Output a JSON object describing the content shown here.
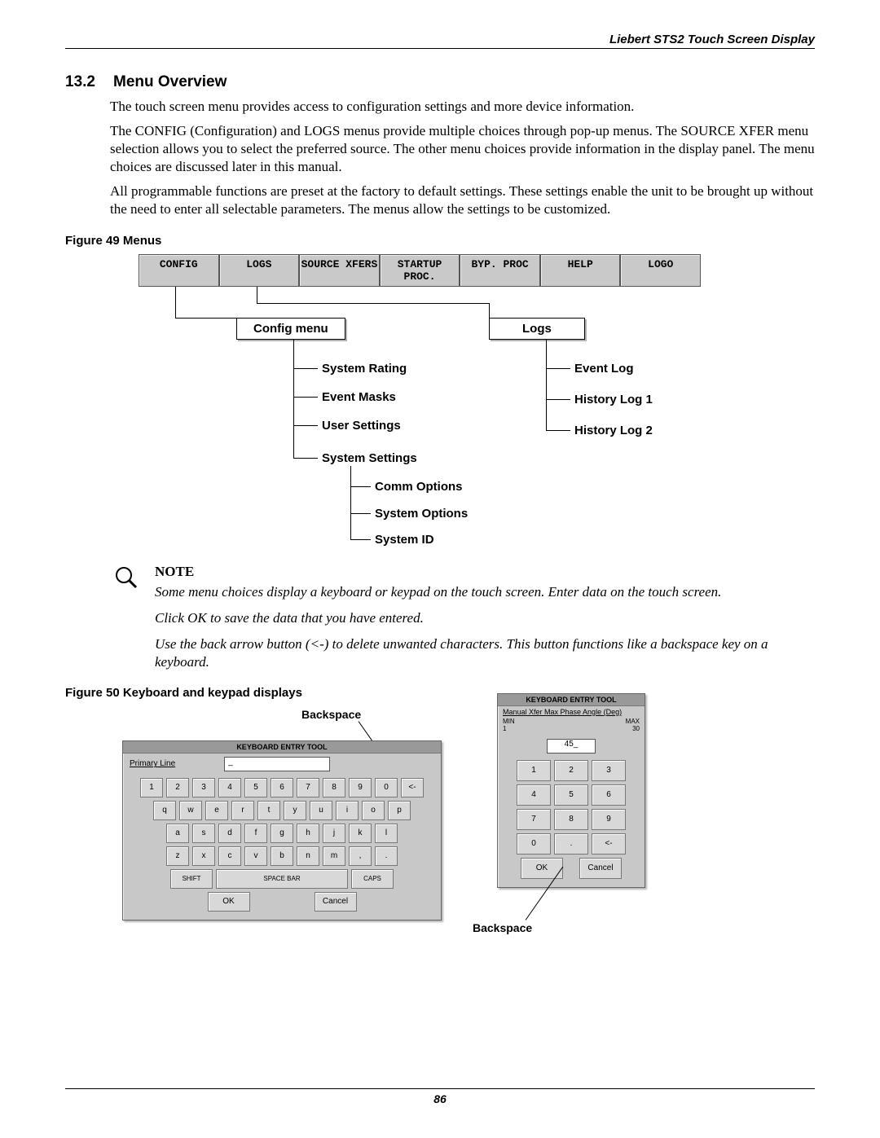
{
  "header": {
    "title": "Liebert STS2 Touch Screen Display"
  },
  "section": {
    "num": "13.2",
    "title": "Menu Overview"
  },
  "paragraphs": {
    "p1": "The touch screen menu provides access to configuration settings and more device information.",
    "p2": "The CONFIG (Configuration) and LOGS menus provide multiple choices through pop-up menus. The SOURCE XFER menu selection allows you to select the preferred source. The other menu choices provide information in the display panel. The menu choices are discussed later in this manual.",
    "p3": "All programmable functions are preset at the factory to default settings. These settings enable the unit to be brought up without the need to enter all selectable parameters. The menus allow the settings to be customized."
  },
  "fig49": {
    "caption": "Figure 49  Menus",
    "menubar": [
      "CONFIG",
      "LOGS",
      "SOURCE XFERS",
      "STARTUP PROC.",
      "BYP. PROC",
      "HELP",
      "LOGO"
    ],
    "box_config": "Config menu",
    "box_logs": "Logs",
    "config_items": [
      "System Rating",
      "Event Masks",
      "User Settings",
      "System Settings"
    ],
    "sys_sub": [
      "Comm Options",
      "System Options",
      "System ID"
    ],
    "logs_items": [
      "Event Log",
      "History Log 1",
      "History Log 2"
    ]
  },
  "note": {
    "title": "NOTE",
    "l1": "Some menu choices display a keyboard or keypad on the touch screen. Enter data on the touch screen.",
    "l2": "Click OK to save the data that you have entered.",
    "l3": "Use the back arrow button (<-) to delete unwanted characters. This button functions like a backspace key on a keyboard."
  },
  "fig50": {
    "caption": "Figure 50  Keyboard and keypad displays",
    "backspace_label": "Backspace",
    "kb": {
      "title": "KEYBOARD ENTRY TOOL",
      "prompt": "Primary Line",
      "value": "_",
      "row1": [
        "1",
        "2",
        "3",
        "4",
        "5",
        "6",
        "7",
        "8",
        "9",
        "0",
        "<-"
      ],
      "row2": [
        "q",
        "w",
        "e",
        "r",
        "t",
        "y",
        "u",
        "i",
        "o",
        "p"
      ],
      "row3": [
        "a",
        "s",
        "d",
        "f",
        "g",
        "h",
        "j",
        "k",
        "l"
      ],
      "row4": [
        "z",
        "x",
        "c",
        "v",
        "b",
        "n",
        "m",
        ",",
        "."
      ],
      "shift": "SHIFT",
      "space": "SPACE BAR",
      "caps": "CAPS",
      "ok": "OK",
      "cancel": "Cancel"
    },
    "kp": {
      "title": "KEYBOARD ENTRY TOOL",
      "prompt": "Manual Xfer Max Phase Angle (Deg)",
      "min_label": "MIN",
      "min_val": "1",
      "max_label": "MAX",
      "max_val": "30",
      "value": "45_",
      "rows": [
        [
          "1",
          "2",
          "3"
        ],
        [
          "4",
          "5",
          "6"
        ],
        [
          "7",
          "8",
          "9"
        ],
        [
          "0",
          ".",
          "<-"
        ]
      ],
      "ok": "OK",
      "cancel": "Cancel"
    }
  },
  "footer": {
    "page": "86"
  }
}
